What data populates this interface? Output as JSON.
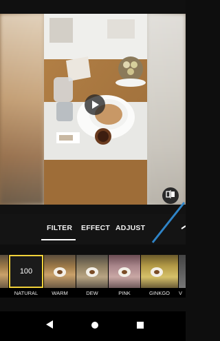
{
  "preview": {
    "play_icon": "play-icon",
    "compare_icon": "compare-icon"
  },
  "tabs": [
    {
      "label": "FILTER",
      "selected": true
    },
    {
      "label": "EFFECT",
      "selected": false
    },
    {
      "label": "ADJUST",
      "selected": false
    }
  ],
  "filters": {
    "intensity_value": "100",
    "items": [
      {
        "label": "NATURAL"
      },
      {
        "label": "WARM"
      },
      {
        "label": "DEW"
      },
      {
        "label": "PINK"
      },
      {
        "label": "GINKGO"
      },
      {
        "label": "V"
      }
    ],
    "selected_label": "NATURAL"
  },
  "navbar": {
    "back_icon": "back-icon",
    "home_icon": "home-icon",
    "recents_icon": "recents-icon"
  },
  "colors": {
    "accent": "#f2d23a",
    "pointer": "#2f84c7"
  }
}
